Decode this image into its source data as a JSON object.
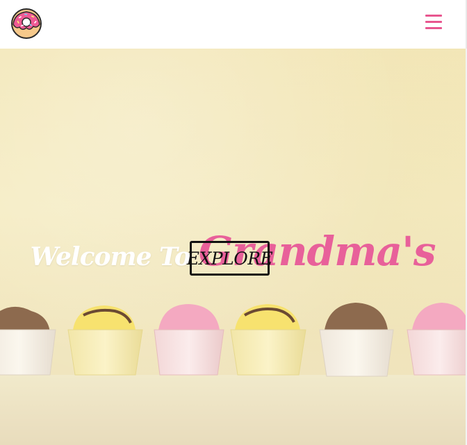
{
  "navbar": {
    "logo_icon": "donut-icon",
    "menu_icon": "hamburger-menu-icon",
    "accent_color": "#e8568f"
  },
  "hero": {
    "welcome": "Welcome To",
    "brand": "Grandma's",
    "explore_label": "EXPLORE",
    "background_icon": "cupcakes-photo",
    "brand_color": "#e8609a"
  }
}
